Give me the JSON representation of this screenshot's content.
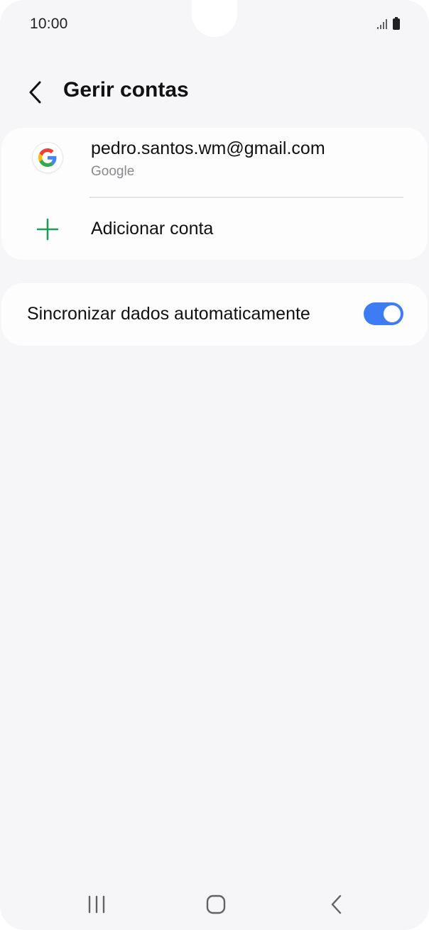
{
  "status_bar": {
    "time": "10:00",
    "icons": [
      "signal-icon",
      "battery-icon"
    ]
  },
  "header": {
    "title": "Gerir contas",
    "back_icon": "chevron-left-icon"
  },
  "accounts": [
    {
      "email": "pedro.santos.wm@gmail.com",
      "provider": "Google",
      "icon": "google-logo-icon"
    }
  ],
  "add_account": {
    "label": "Adicionar conta",
    "icon": "plus-icon"
  },
  "sync": {
    "label": "Sincronizar dados automaticamente",
    "enabled": true
  },
  "nav_bar": {
    "buttons": [
      "recent-apps-icon",
      "home-icon",
      "back-icon"
    ]
  },
  "colors": {
    "background": "#f6f6f8",
    "card": "#fdfdfe",
    "accent_toggle": "#3e7cf4",
    "accent_plus": "#1f9d57",
    "secondary_text": "#8a8a8e"
  }
}
